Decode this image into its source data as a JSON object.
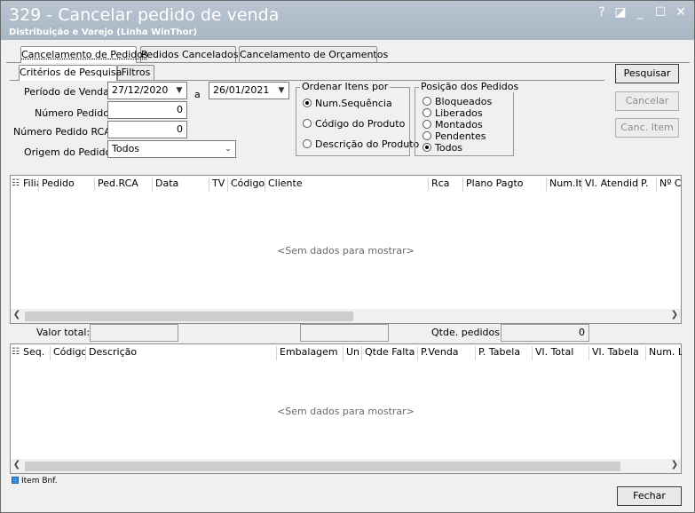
{
  "window": {
    "title": "329 - Cancelar pedido de venda",
    "subtitle": "Distribuição e Varejo (Linha WinThor)",
    "help": "?",
    "restore": "◪",
    "minimize": "_",
    "maximize": "☐",
    "close": "✕"
  },
  "main_tabs": [
    "Cancelamento de Pedidos",
    "Pedidos Cancelados",
    "Cancelamento de Orçamentos"
  ],
  "sub_tabs": [
    "Critérios de Pesquisa",
    "Filtros"
  ],
  "criteria": {
    "periodo_label": "Período de Venda:",
    "date_from": "27/12/2020",
    "date_sep": "a",
    "date_to": "26/01/2021",
    "numero_pedido_label": "Número Pedido:",
    "numero_pedido_value": "0",
    "numero_rca_label": "Número Pedido RCA:",
    "numero_rca_value": "0",
    "origem_label": "Origem do Pedido:",
    "origem_value": "Todos"
  },
  "ordenar": {
    "title": "Ordenar Itens por",
    "options": [
      "Num.Sequência",
      "Código do Produto",
      "Descrição do Produto"
    ],
    "selected": 0
  },
  "posicao": {
    "title": "Posição dos Pedidos",
    "options": [
      "Bloqueados",
      "Liberados",
      "Montados",
      "Pendentes",
      "Todos"
    ],
    "selected": 4
  },
  "buttons": {
    "pesquisar": "Pesquisar",
    "cancelar": "Cancelar",
    "canc_item": "Canc. Item",
    "fechar": "Fechar"
  },
  "orders_grid": {
    "columns": [
      "Filia",
      "Pedido",
      "Ped.RCA",
      "Data",
      "TV",
      "Código",
      "Cliente",
      "Rca",
      "Plano Pagto",
      "Num.Ite",
      "Vl. Atendido",
      "P.",
      "Nº Ca"
    ],
    "empty_text": "<Sem dados para mostrar>"
  },
  "totals": {
    "valor_total_label": "Valor total:",
    "qtde_pedidos_label": "Qtde. pedidos:",
    "qtde_pedidos_value": "0"
  },
  "items_grid": {
    "columns": [
      "Seq.",
      "Código",
      "Descrição",
      "Embalagem",
      "Un",
      "Qtde Falta",
      "P.Venda",
      "P. Tabela",
      "Vl. Total",
      "Vl. Tabela",
      "Num. Lo"
    ],
    "empty_text": "<Sem dados para mostrar>"
  },
  "legend": {
    "item_bnf": "Item Bnf.",
    "color": "#3d8fe6"
  }
}
